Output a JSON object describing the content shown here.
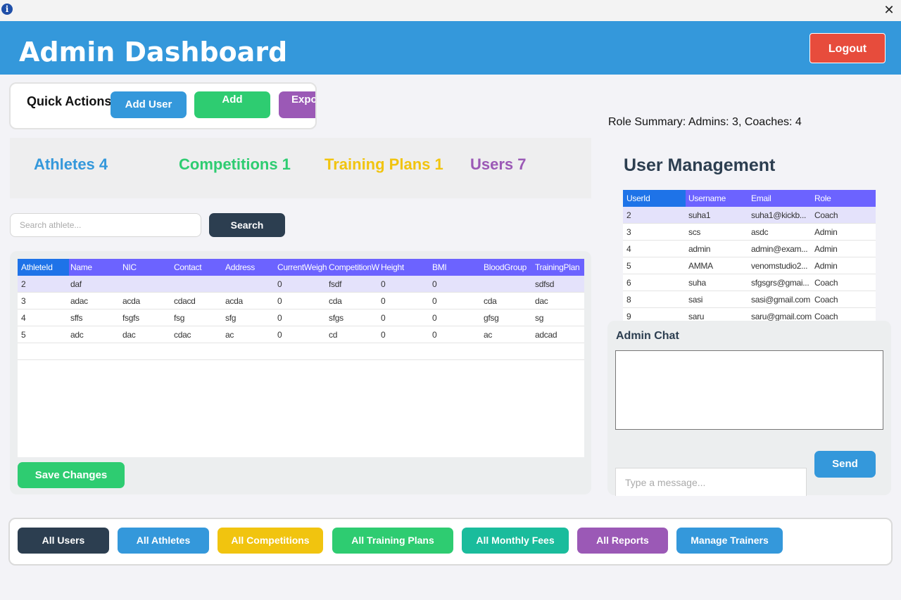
{
  "window": {
    "close_symbol": "✕",
    "info_symbol": "i"
  },
  "header": {
    "title": "Admin Dashboard",
    "logout_label": "Logout"
  },
  "quick_actions": {
    "label": "Quick Actions",
    "add_user_label": "Add User",
    "add_label": "Add",
    "export_label": "Expo"
  },
  "role_summary": "Role Summary: Admins: 3, Coaches: 4",
  "stats": {
    "athletes": "Athletes 4",
    "competitions": "Competitions 1",
    "training_plans": "Training Plans 1",
    "users": "Users 7"
  },
  "search": {
    "placeholder": "Search athlete...",
    "button_label": "Search"
  },
  "athletes_table": {
    "columns": [
      "AthleteId",
      "Name",
      "NIC",
      "Contact",
      "Address",
      "CurrentWeigh",
      "CompetitionW",
      "Height",
      "BMI",
      "BloodGroup",
      "TrainingPlan"
    ],
    "rows": [
      [
        "2",
        "daf",
        "",
        "",
        "",
        "0",
        "fsdf",
        "0",
        "0",
        "",
        "sdfsd"
      ],
      [
        "3",
        "adac",
        "acda",
        "cdacd",
        "acda",
        "0",
        "cda",
        "0",
        "0",
        "cda",
        "dac"
      ],
      [
        "4",
        "sffs",
        "fsgfs",
        "fsg",
        "sfg",
        "0",
        "sfgs",
        "0",
        "0",
        "gfsg",
        "sg"
      ],
      [
        "5",
        "adc",
        "dac",
        "cdac",
        "ac",
        "0",
        "cd",
        "0",
        "0",
        "ac",
        "adcad"
      ]
    ],
    "selected_row": 0
  },
  "save_changes_label": "Save Changes",
  "user_management": {
    "title": "User Management",
    "columns": [
      "UserId",
      "Username",
      "Email",
      "Role"
    ],
    "rows": [
      [
        "2",
        "suha1",
        "suha1@kickb...",
        "Coach"
      ],
      [
        "3",
        "scs",
        "asdc",
        "Admin"
      ],
      [
        "4",
        "admin",
        "admin@exam...",
        "Admin"
      ],
      [
        "5",
        "AMMA",
        "venomstudio2...",
        "Admin"
      ],
      [
        "6",
        "suha",
        "sfgsgrs@gmai...",
        "Coach"
      ],
      [
        "8",
        "sasi",
        "sasi@gmail.com",
        "Coach"
      ],
      [
        "9",
        "saru",
        "saru@gmail.com",
        "Coach"
      ]
    ],
    "selected_row": 0
  },
  "chat": {
    "title": "Admin Chat",
    "input_placeholder": "Type a message...",
    "send_label": "Send"
  },
  "bottom_nav": {
    "all_users": "All Users",
    "all_athletes": "All Athletes",
    "all_competitions": "All Competitions",
    "all_training_plans": "All Training Plans",
    "all_monthly_fees": "All Monthly Fees",
    "all_reports": "All Reports",
    "manage_trainers": "Manage Trainers"
  },
  "colors": {
    "header": "#3498db",
    "logout": "#e74c3c",
    "grid_header": "#6c63ff",
    "selected_row": "#e4e2fb",
    "dark": "#2c3e50",
    "green": "#2ecc71",
    "yellow": "#f1c40f",
    "purple": "#9b59b6",
    "teal": "#1abc9c"
  }
}
